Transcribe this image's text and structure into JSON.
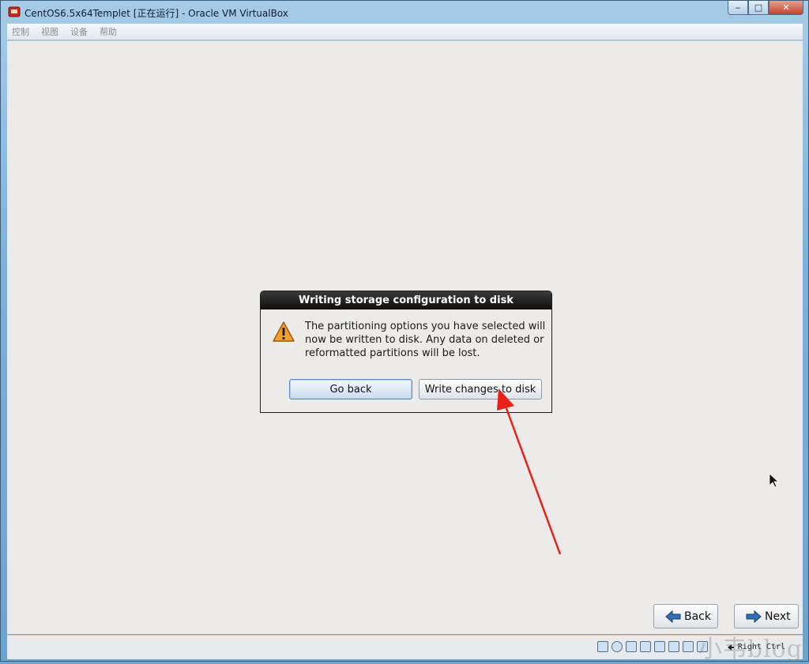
{
  "window": {
    "title": "CentOS6.5x64Templet [正在运行] - Oracle VM VirtualBox",
    "controls": {
      "minimize": "‒",
      "maximize": "□",
      "close": "✕"
    }
  },
  "menubar": {
    "items": [
      "控制",
      "视图",
      "设备",
      "帮助"
    ]
  },
  "dialog": {
    "title": "Writing storage configuration to disk",
    "message": "The partitioning options you have selected will now be written to disk.  Any data on deleted or reformatted partitions will be lost.",
    "go_back_label": "Go back",
    "write_label": "Write changes to disk",
    "warning_color": "#f0a030"
  },
  "nav": {
    "back_label": "Back",
    "next_label": "Next"
  },
  "statusbar": {
    "host_key": "Right Ctrl",
    "watermark": "小韦blog"
  },
  "colors": {
    "annotation": "#e8221a",
    "accent": "#2f6fb8"
  }
}
